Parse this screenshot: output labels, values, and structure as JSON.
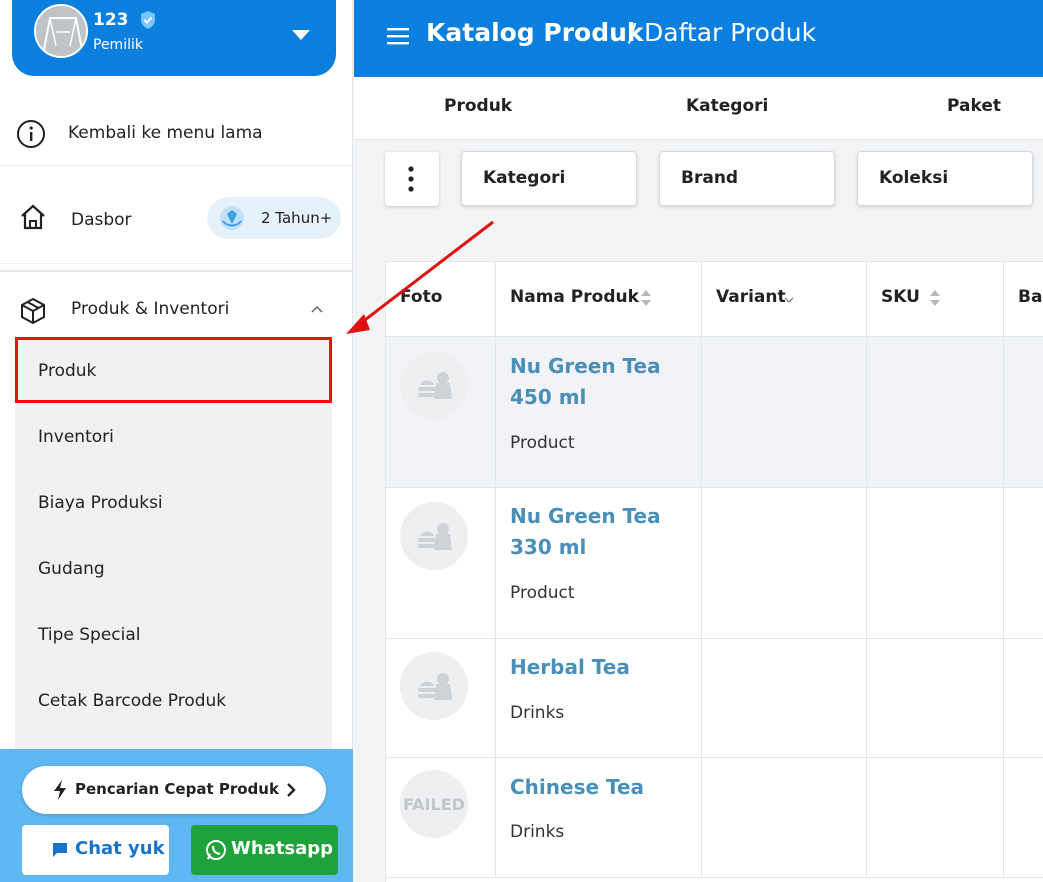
{
  "user": {
    "name": "123",
    "role": "Pemilik"
  },
  "sidebar": {
    "back_label": "Kembali ke menu lama",
    "dashboard_label": "Dasbor",
    "badge_label": "2 Tahun+",
    "section_label": "Produk & Inventori",
    "items": [
      {
        "label": "Produk",
        "active": true
      },
      {
        "label": "Inventori"
      },
      {
        "label": "Biaya Produksi"
      },
      {
        "label": "Gudang"
      },
      {
        "label": "Tipe Special"
      },
      {
        "label": "Cetak Barcode Produk"
      }
    ],
    "quick_search_label": "Pencarian Cepat Produk",
    "chat_label": "Chat yuk",
    "whatsapp_label": "Whatsapp"
  },
  "header": {
    "crumb_main": "Katalog Produk",
    "crumb_sep": "/",
    "crumb_sub": "Daftar Produk"
  },
  "tabs": [
    "Produk",
    "Kategori",
    "Paket"
  ],
  "filters": [
    "Kategori",
    "Brand",
    "Koleksi"
  ],
  "table": {
    "columns": [
      "Foto",
      "Nama Produk",
      "Variant",
      "SKU",
      "Ba"
    ],
    "rows": [
      {
        "name": "Nu Green Tea 450 ml",
        "category": "Product",
        "photo": "placeholder"
      },
      {
        "name": "Nu Green Tea 330 ml",
        "category": "Product",
        "photo": "placeholder"
      },
      {
        "name": "Herbal Tea",
        "category": "Drinks",
        "photo": "placeholder"
      },
      {
        "name": "Chinese Tea",
        "category": "Drinks",
        "photo": "FAILED"
      }
    ]
  },
  "colors": {
    "primary": "#0a7fdd",
    "sidebar_bottom": "#5fb8f3",
    "whatsapp": "#1ea33a",
    "annotation": "#e11111",
    "link": "#4a8fb8"
  }
}
